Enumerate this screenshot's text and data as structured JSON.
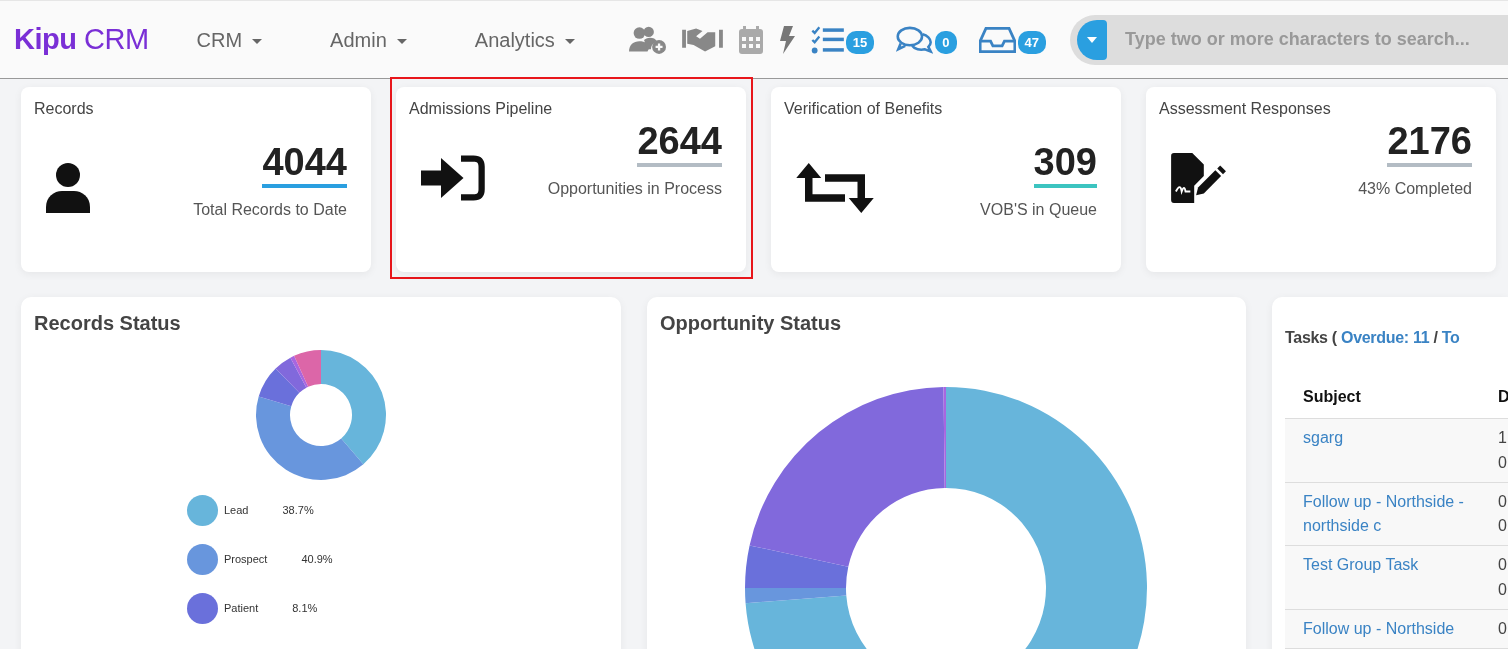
{
  "brand": {
    "name": "Kipu",
    "suffix": "CRM"
  },
  "nav_menus": [
    {
      "label": "CRM"
    },
    {
      "label": "Admin"
    },
    {
      "label": "Analytics"
    }
  ],
  "badges": [
    {
      "count": "15"
    },
    {
      "count": "0"
    },
    {
      "count": "47"
    }
  ],
  "search": {
    "placeholder": "Type two or more characters to search..."
  },
  "stat_cards": [
    {
      "title": "Records",
      "value": "4044",
      "caption": "Total Records to Date",
      "color": "#2a9fe0",
      "highlighted": false
    },
    {
      "title": "Admissions Pipeline",
      "value": "2644",
      "caption": "Opportunities in Process",
      "color": "#b3bcc4",
      "highlighted": true
    },
    {
      "title": "Verification of Benefits",
      "value": "309",
      "caption": "VOB'S in Queue",
      "color": "#3cc4c0",
      "highlighted": false
    },
    {
      "title": "Assessment Responses",
      "value": "2176",
      "caption": "43% Completed",
      "color": "#b3bcc4",
      "highlighted": false
    }
  ],
  "records_status": {
    "title": "Records Status",
    "legend": [
      {
        "label": "Lead",
        "value": "38.7%",
        "color": "#67b5db"
      },
      {
        "label": "Prospect",
        "value": "40.9%",
        "color": "#6896dd"
      },
      {
        "label": "Patient",
        "value": "8.1%",
        "color": "#6a70db"
      }
    ]
  },
  "opportunity_status": {
    "title": "Opportunity Status"
  },
  "tasks": {
    "title_prefix": "Tasks (",
    "overdue_link": "Overdue: 11",
    "separator": "/",
    "title_cut": "To",
    "columns": [
      "Subject",
      "D"
    ],
    "rows": [
      {
        "subject": "sgarg",
        "date_lines": [
          "1",
          "0"
        ]
      },
      {
        "subject": "Follow up - Northside - northside c",
        "date_lines": [
          "0",
          "0"
        ]
      },
      {
        "subject": "Test Group Task",
        "date_lines": [
          "0",
          "0"
        ]
      },
      {
        "subject": "Follow up - Northside",
        "date_lines": [
          "0"
        ]
      }
    ]
  }
}
